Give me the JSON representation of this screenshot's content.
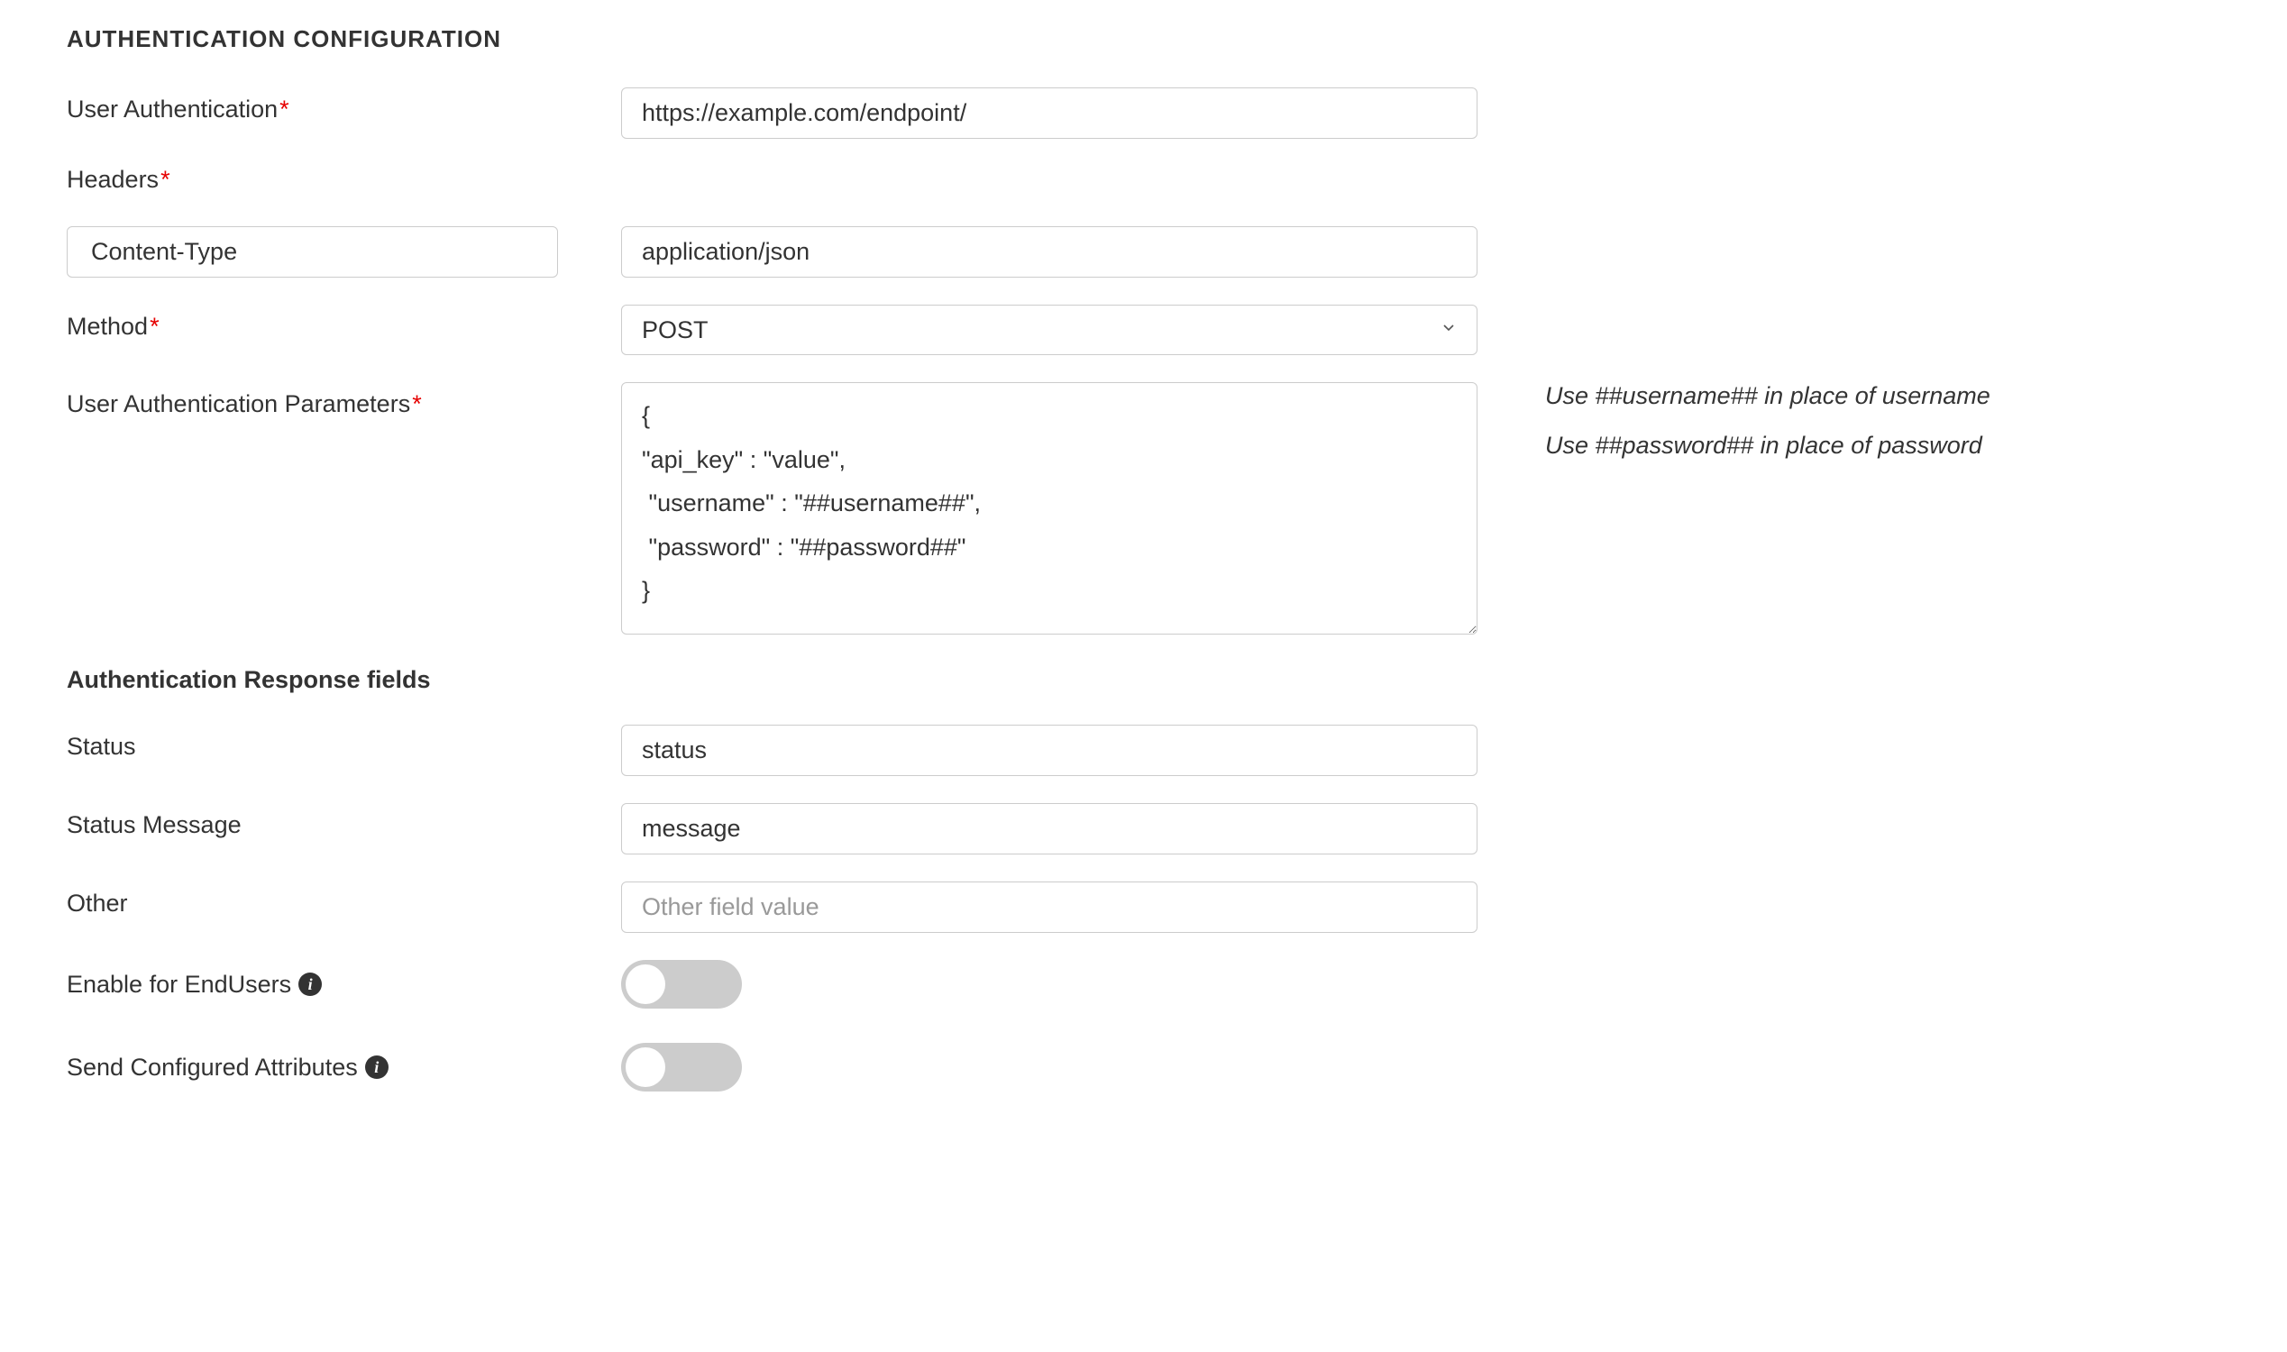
{
  "section_title": "AUTHENTICATION CONFIGURATION",
  "labels": {
    "user_authentication": "User Authentication",
    "headers": "Headers",
    "method": "Method",
    "user_auth_params": "User Authentication Parameters",
    "auth_response_fields": "Authentication Response fields",
    "status": "Status",
    "status_message": "Status Message",
    "other": "Other",
    "enable_for_endusers": "Enable for EndUsers",
    "send_configured_attributes": "Send Configured Attributes"
  },
  "values": {
    "user_authentication": "https://example.com/endpoint/",
    "header_key": "Content-Type",
    "header_value": "application/json",
    "method_selected": "POST",
    "user_auth_params": "{\n\"api_key\" : \"value\",\n \"username\" : \"##username##\",\n \"password\" : \"##password##\"\n}",
    "status": "status",
    "status_message": "message",
    "other": "",
    "enable_for_endusers": false,
    "send_configured_attributes": false
  },
  "placeholders": {
    "other": "Other field value"
  },
  "method_options": [
    "POST"
  ],
  "hints": {
    "line1": "Use ##username## in place of username",
    "line2": "Use ##password## in place of password"
  }
}
